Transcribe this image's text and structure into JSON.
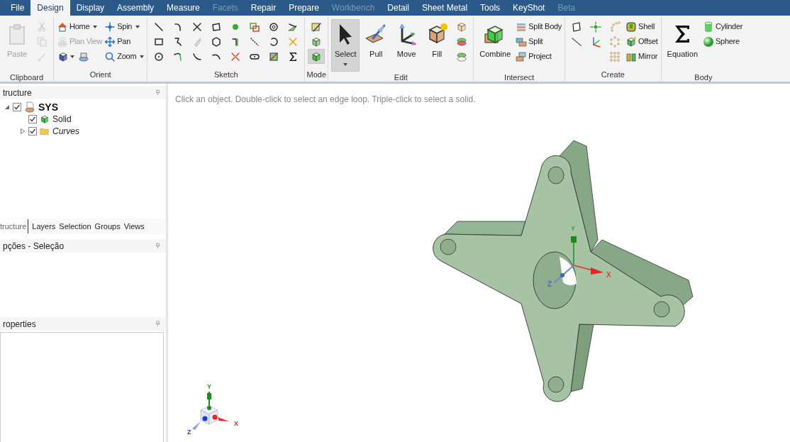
{
  "menu_tabs": [
    {
      "label": "File",
      "selected": false,
      "disabled": false
    },
    {
      "label": "Design",
      "selected": true,
      "disabled": false
    },
    {
      "label": "Display",
      "selected": false,
      "disabled": false
    },
    {
      "label": "Assembly",
      "selected": false,
      "disabled": false
    },
    {
      "label": "Measure",
      "selected": false,
      "disabled": false
    },
    {
      "label": "Facets",
      "selected": false,
      "disabled": true
    },
    {
      "label": "Repair",
      "selected": false,
      "disabled": false
    },
    {
      "label": "Prepare",
      "selected": false,
      "disabled": false
    },
    {
      "label": "Workbench",
      "selected": false,
      "disabled": true
    },
    {
      "label": "Detail",
      "selected": false,
      "disabled": false
    },
    {
      "label": "Sheet Metal",
      "selected": false,
      "disabled": false
    },
    {
      "label": "Tools",
      "selected": false,
      "disabled": false
    },
    {
      "label": "KeyShot",
      "selected": false,
      "disabled": false
    },
    {
      "label": "Beta",
      "selected": false,
      "disabled": true
    }
  ],
  "ribbon": [
    {
      "label": "Clipboard",
      "columns": [
        [
          [
            {
              "kind": "large",
              "label": "Paste",
              "disabled": true
            }
          ]
        ],
        [
          [
            {
              "kind": "icon",
              "disabled": true
            }
          ],
          [
            {
              "kind": "icon",
              "disabled": true
            }
          ],
          [
            {
              "kind": "icon",
              "disabled": true
            }
          ]
        ]
      ]
    },
    {
      "label": "Orient",
      "columns": [
        [
          [
            {
              "kind": "small",
              "label": "Home",
              "dropdown": true,
              "disabled": false
            }
          ],
          [
            {
              "kind": "small",
              "label": "Plan View",
              "dropdown": false,
              "disabled": true
            }
          ],
          [
            {
              "kind": "icon",
              "dropdown": true,
              "disabled": false
            },
            {
              "kind": "icon",
              "dropdown": false,
              "disabled": false
            }
          ]
        ],
        [
          [
            {
              "kind": "small",
              "label": "Spin",
              "dropdown": true,
              "disabled": false
            }
          ],
          [
            {
              "kind": "small",
              "label": "Pan",
              "dropdown": false,
              "disabled": false
            }
          ],
          [
            {
              "kind": "small",
              "label": "Zoom",
              "dropdown": true,
              "disabled": false
            }
          ]
        ]
      ]
    },
    {
      "label": "Sketch",
      "columns": [
        [
          [
            {
              "kind": "icon"
            }
          ],
          [
            {
              "kind": "icon"
            }
          ],
          [
            {
              "kind": "icon"
            }
          ]
        ],
        [
          [
            {
              "kind": "icon"
            }
          ],
          [
            {
              "kind": "icon"
            }
          ],
          [
            {
              "kind": "icon"
            }
          ]
        ],
        [
          [
            {
              "kind": "icon"
            }
          ],
          [
            {
              "kind": "icon"
            }
          ],
          [
            {
              "kind": "icon"
            }
          ]
        ],
        [
          [
            {
              "kind": "icon"
            }
          ],
          [
            {
              "kind": "icon"
            }
          ],
          [
            {
              "kind": "icon"
            }
          ]
        ],
        [
          [
            {
              "kind": "icon"
            }
          ],
          [
            {
              "kind": "icon"
            }
          ],
          [
            {
              "kind": "icon"
            }
          ]
        ],
        [
          [
            {
              "kind": "icon"
            }
          ],
          [
            {
              "kind": "icon"
            }
          ],
          [
            {
              "kind": "icon"
            }
          ]
        ],
        [
          [
            {
              "kind": "icon"
            }
          ],
          [
            {
              "kind": "icon"
            }
          ],
          [
            {
              "kind": "icon"
            }
          ]
        ],
        [
          [
            {
              "kind": "icon"
            }
          ],
          [
            {
              "kind": "icon"
            }
          ],
          [
            {
              "kind": "icon"
            }
          ]
        ]
      ]
    },
    {
      "label": "Mode",
      "columns": [
        [
          [
            {
              "kind": "icon",
              "selected": false
            }
          ],
          [
            {
              "kind": "icon",
              "selected": false
            }
          ],
          [
            {
              "kind": "icon",
              "selected": true
            }
          ]
        ]
      ]
    },
    {
      "label": "Edit",
      "columns": [
        [
          [
            {
              "kind": "large",
              "label": "Select",
              "dropdown": true,
              "selected": true
            }
          ]
        ],
        [
          [
            {
              "kind": "large",
              "label": "Pull",
              "dropdown": false,
              "selected": false
            }
          ]
        ],
        [
          [
            {
              "kind": "large",
              "label": "Move",
              "dropdown": false,
              "selected": false
            }
          ]
        ],
        [
          [
            {
              "kind": "large",
              "label": "Fill",
              "dropdown": false,
              "selected": false
            }
          ]
        ],
        [
          [
            {
              "kind": "icon"
            }
          ],
          [
            {
              "kind": "icon"
            }
          ],
          [
            {
              "kind": "icon"
            }
          ]
        ]
      ]
    },
    {
      "label": "Intersect",
      "columns": [
        [
          [
            {
              "kind": "large",
              "label": "Combine"
            }
          ]
        ],
        [
          [
            {
              "kind": "small",
              "label": "Split Body"
            }
          ],
          [
            {
              "kind": "small",
              "label": "Split"
            }
          ],
          [
            {
              "kind": "small",
              "label": "Project"
            }
          ]
        ]
      ]
    },
    {
      "label": "Create",
      "columns": [
        [
          [
            {
              "kind": "icon"
            }
          ],
          [
            {
              "kind": "icon"
            }
          ]
        ],
        [
          [
            {
              "kind": "icon"
            }
          ],
          [
            {
              "kind": "icon"
            }
          ]
        ],
        [
          [
            {
              "kind": "icon"
            }
          ],
          [
            {
              "kind": "icon"
            }
          ],
          [
            {
              "kind": "icon"
            }
          ]
        ],
        [
          [
            {
              "kind": "small",
              "label": "Shell"
            }
          ],
          [
            {
              "kind": "small",
              "label": "Offset"
            }
          ],
          [
            {
              "kind": "small",
              "label": "Mirror"
            }
          ]
        ]
      ]
    },
    {
      "label": "Body",
      "columns": [
        [
          [
            {
              "kind": "large",
              "label": "Equation"
            }
          ]
        ],
        [
          [
            {
              "kind": "small",
              "label": "Cylinder"
            }
          ],
          [
            {
              "kind": "small",
              "label": "Sphere"
            }
          ]
        ]
      ]
    }
  ],
  "structure_panel": {
    "title": "tructure",
    "tree": [
      {
        "label": "SYS",
        "checked": true,
        "expanded": true,
        "children": [
          {
            "label": "Solid",
            "checked": true
          },
          {
            "label": "Curves",
            "checked": true,
            "expanded": false
          }
        ]
      }
    ]
  },
  "panel_tabs": [
    {
      "label": "tructure",
      "selected": true
    },
    {
      "label": "Layers",
      "selected": false
    },
    {
      "label": "Selection",
      "selected": false
    },
    {
      "label": "Groups",
      "selected": false
    },
    {
      "label": "Views",
      "selected": false
    }
  ],
  "options_panel": {
    "title": "pções - Seleção"
  },
  "properties_panel": {
    "title": "roperties"
  },
  "viewport": {
    "hint": "Click an object. Double-click to select an edge loop. Triple-click to select a solid.",
    "model_axes": {
      "x": "X",
      "y": "Y",
      "z": "Z"
    },
    "corner_triad": {
      "x": "X",
      "y": "Y",
      "z": "Z"
    }
  }
}
